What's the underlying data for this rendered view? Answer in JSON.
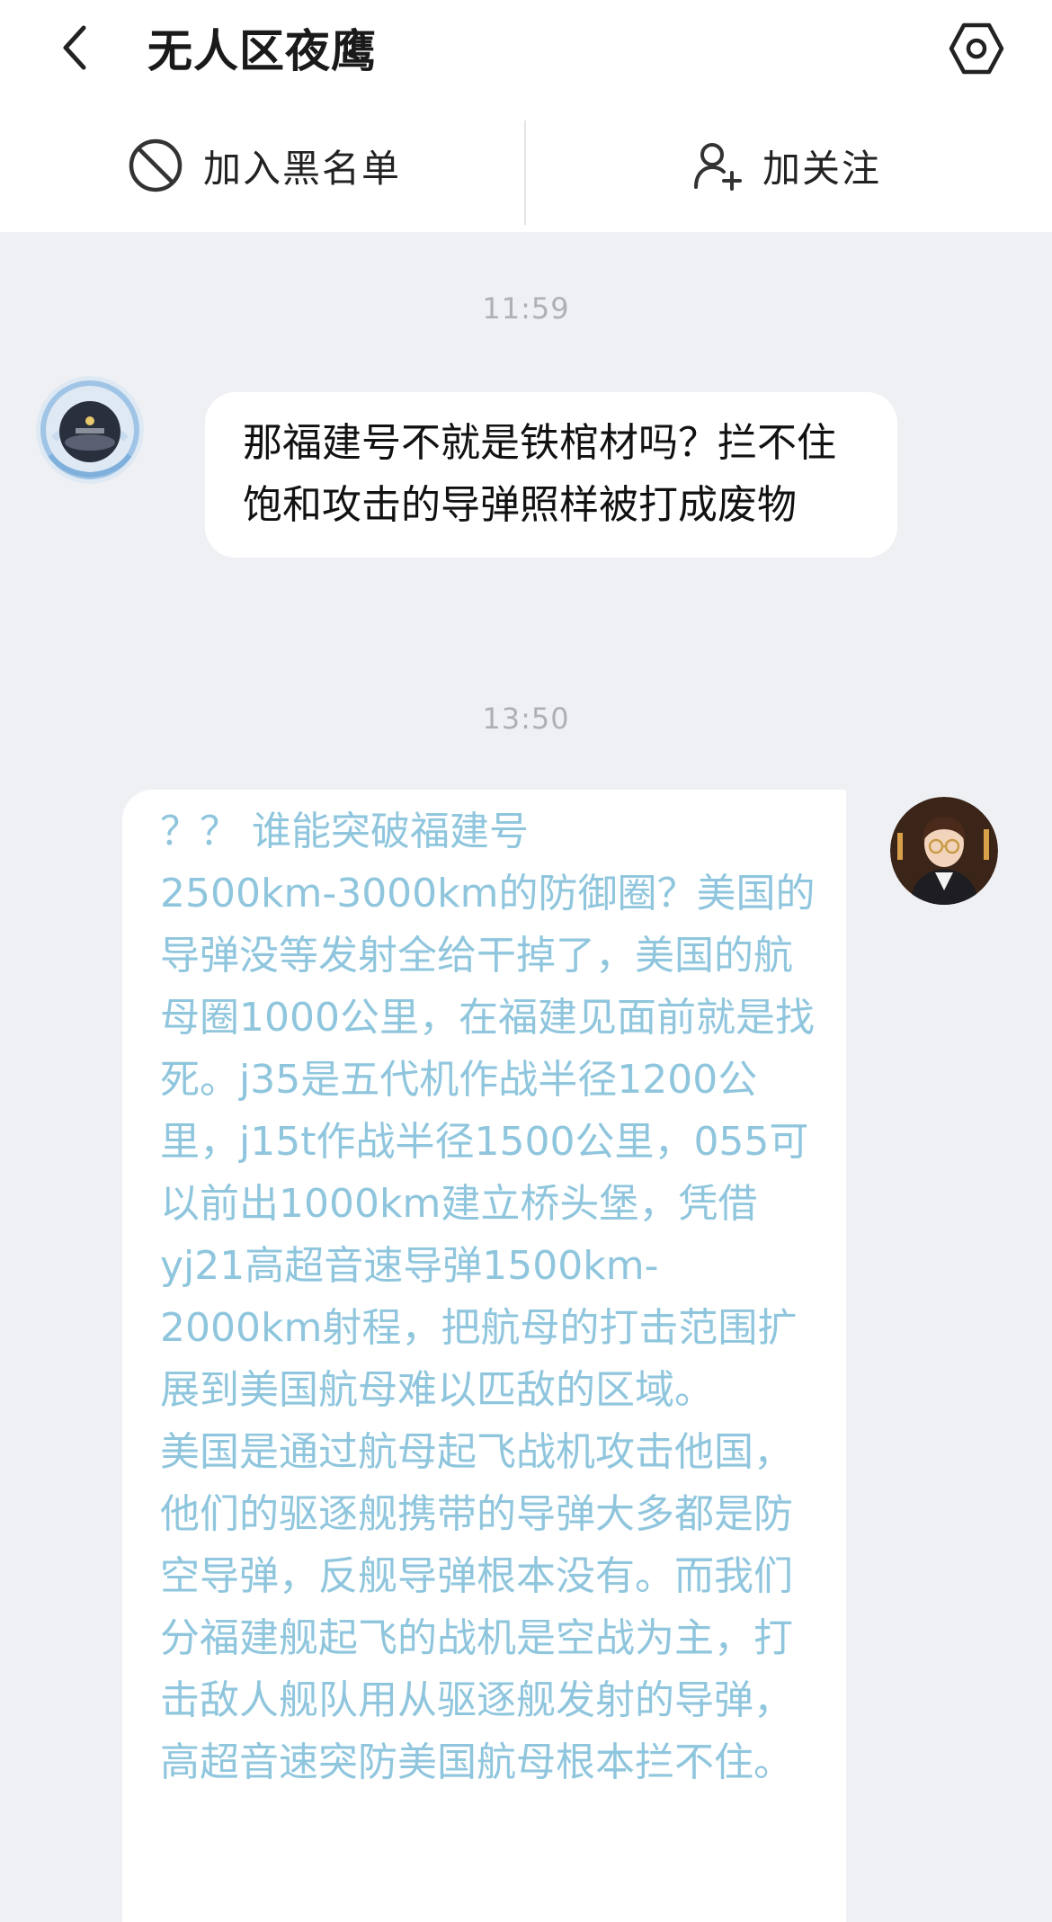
{
  "header": {
    "title": "无人区夜鹰",
    "back_icon": "chevron-left-icon",
    "settings_icon": "hexagon-settings-icon"
  },
  "actions": {
    "block_label": "加入黑名单",
    "block_icon": "prohibited-icon",
    "follow_label": "加关注",
    "follow_icon": "add-user-icon"
  },
  "chat": {
    "messages": [
      {
        "time": "11:59",
        "direction": "incoming",
        "text": "那福建号不就是铁棺材吗？拦不住饱和攻击的导弹照样被打成废物"
      },
      {
        "time": "13:50",
        "direction": "outgoing",
        "text": "？？ 谁能突破福建号\n2500km-3000km的防御圈？美国的导弹没等发射全给干掉了，美国的航母圈1000公里，在福建见面前就是找死。j35是五代机作战半径1200公里，j15t作战半径1500公里，055可以前出1000km建立桥头堡，凭借yj21高超音速导弹1500km-2000km射程，把航母的打击范围扩展到美国航母难以匹敌的区域。\n美国是通过航母起飞战机攻击他国，他们的驱逐舰携带的导弹大多都是防空导弹，反舰导弹根本没有。而我们分福建舰起飞的战机是空战为主，打击敌人舰队用从驱逐舰发射的导弹，高超音速突防美国航母根本拦不住。"
      }
    ]
  },
  "colors": {
    "background": "#eff0f4",
    "bubble": "#ffffff",
    "outgoing_text": "#8fc6dd",
    "incoming_text": "#111111",
    "timestamp": "#aeb0b6"
  }
}
